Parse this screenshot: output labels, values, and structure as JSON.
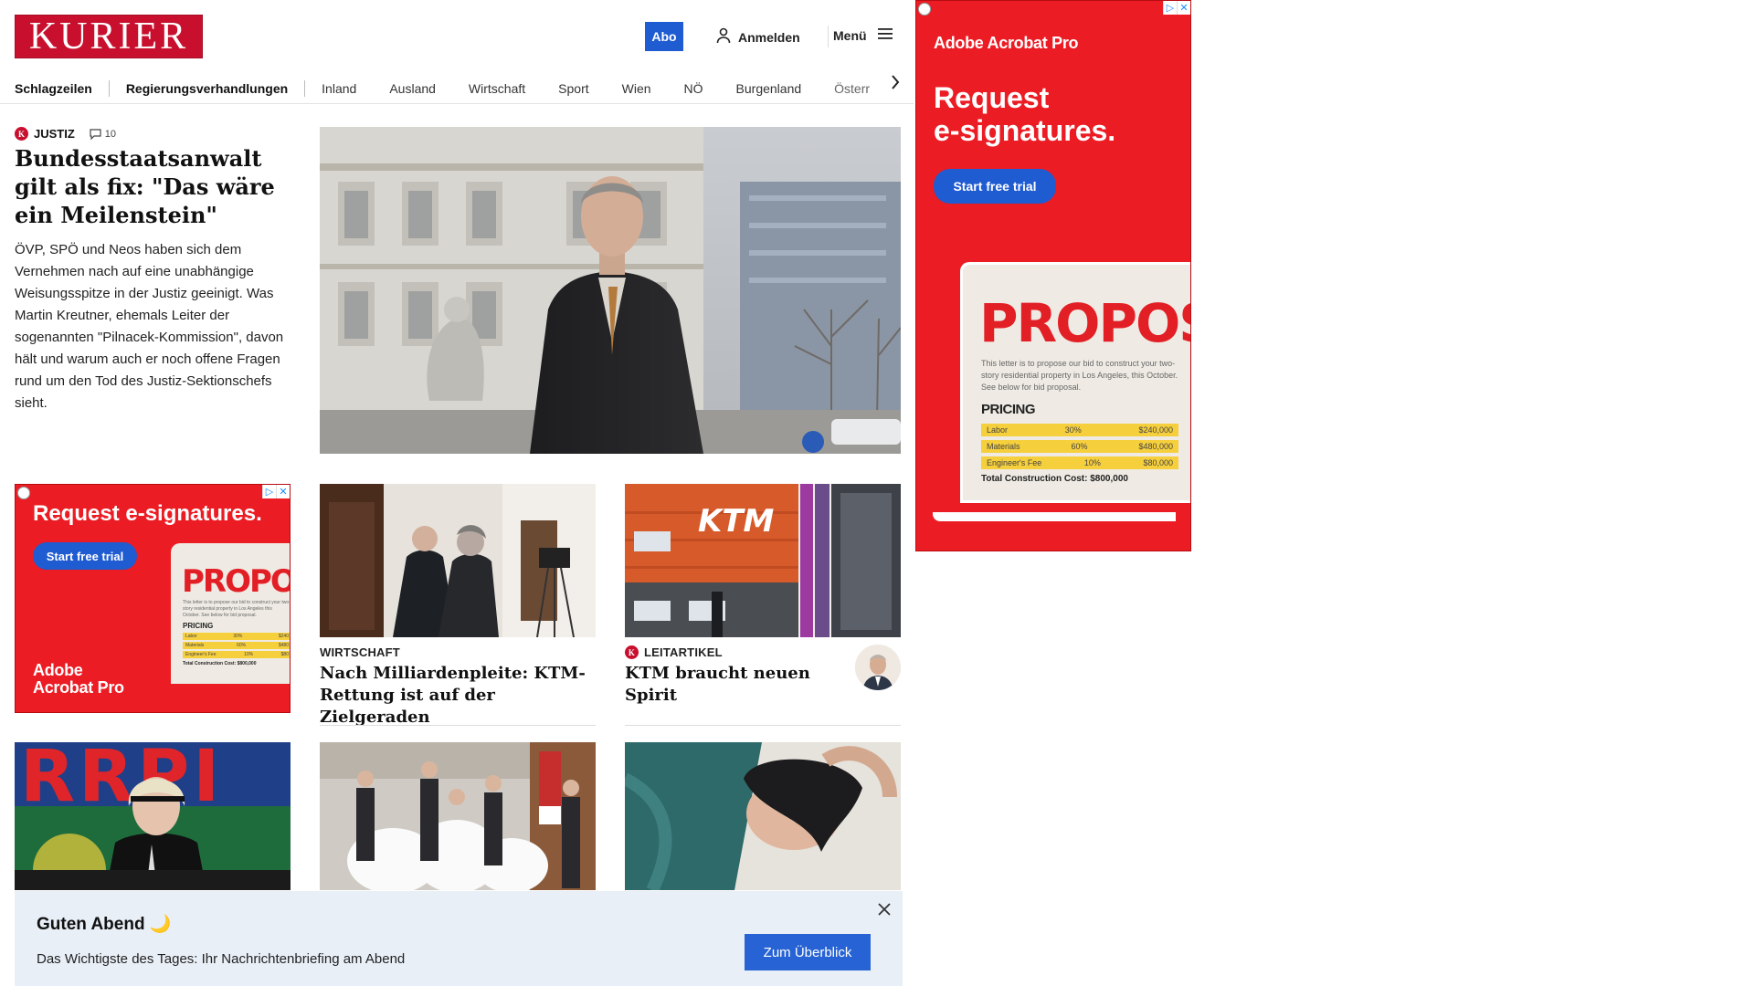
{
  "header": {
    "logo_text": "KURIER",
    "abo_label": "Abo",
    "login_label": "Anmelden",
    "menu_label": "Menü"
  },
  "nav": {
    "items": [
      "Schlagzeilen",
      "Regierungsverhandlungen",
      "Inland",
      "Ausland",
      "Wirtschaft",
      "Sport",
      "Wien",
      "NÖ",
      "Burgenland",
      "Österr"
    ]
  },
  "lead": {
    "kicker": "JUSTIZ",
    "comment_count": "10",
    "title": "Bundesstaatsanwalt gilt als fix: \"Das wäre ein Meilenstein\"",
    "text": "ÖVP, SPÖ und Neos haben sich dem Vernehmen nach auf eine unabhängige Weisungsspitze in der Justiz geeinigt. Was Martin Kreutner, ehemals Leiter der sogenannten \"Pilnacek-Kommission\", davon hält und warum auch er noch offene Fragen rund um den Tod des Justiz-Sektionschefs sieht."
  },
  "cards": [
    {
      "label": "WIRTSCHAFT",
      "title": "Nach Milliardenpleite: KTM-Rettung ist auf der Zielgeraden"
    },
    {
      "label": "LEITARTIKEL",
      "title": "KTM braucht neuen Spirit"
    }
  ],
  "ktm_sign": "KTM",
  "ad": {
    "brand": "Adobe Acrobat Pro",
    "brand_line1": "Adobe",
    "brand_line2": "Acrobat Pro",
    "headline_small": "Request e-signatures.",
    "headline_line1": "Request",
    "headline_line2": "e-signatures.",
    "cta": "Start free trial",
    "proposal_title": "PROPOSAL",
    "proposal_text": "This letter is to propose our bid to construct your two-story residential property in Los Angeles, this October. See below for bid proposal.",
    "pricing_label": "PRICING",
    "rows": [
      {
        "item": "Labor",
        "pct": "30%",
        "amount": "$240,000"
      },
      {
        "item": "Materials",
        "pct": "60%",
        "amount": "$480,000"
      },
      {
        "item": "Engineer's Fee",
        "pct": "10%",
        "amount": "$80,000"
      }
    ],
    "total": "Total Construction Cost: $800,000",
    "small_rows": [
      {
        "item": "Labor",
        "pct": "30%",
        "amount": "$240"
      },
      {
        "item": "Materials",
        "pct": "60%",
        "amount": "$480"
      },
      {
        "item": "Engineer's Fee",
        "pct": "10%",
        "amount": "$80"
      }
    ],
    "small_total": "Total Construction Cost: $800,000",
    "small_proposal_title": "PROPOSAL",
    "small_pricing_label": "PRICING",
    "small_proposal_text": "This letter is to propose our bid to construct your two-story residential property in Los Angeles this October. See below for bid proposal."
  },
  "banner": {
    "title": "Guten Abend 🌙",
    "text": "Das Wichtigste des Tages: Ihr Nachrichtenbriefing am Abend",
    "button": "Zum Überblick"
  },
  "colors": {
    "brand_red": "#c8102e",
    "ad_red": "#ec1c24",
    "accent_blue": "#1f5bd1",
    "banner_bg": "#e9eff7"
  }
}
